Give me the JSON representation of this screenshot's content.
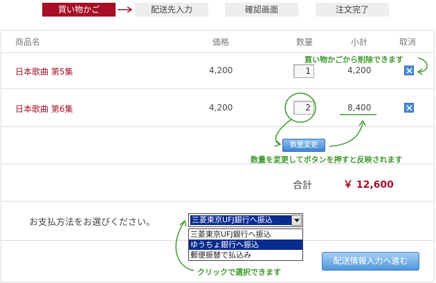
{
  "steps": [
    {
      "label": "買い物かご"
    },
    {
      "label": "配送先入力"
    },
    {
      "label": "確認画面"
    },
    {
      "label": "注文完了"
    }
  ],
  "table": {
    "headers": {
      "name": "商品名",
      "price": "価格",
      "qty": "数量",
      "subtotal": "小計",
      "cancel": "取消"
    },
    "rows": [
      {
        "name": "日本歌曲 第5集",
        "price": "4,200",
        "qty": "1",
        "subtotal": "4,200"
      },
      {
        "name": "日本歌曲 第6集",
        "price": "4,200",
        "qty": "2",
        "subtotal": "8,400"
      }
    ]
  },
  "update_button": "数量変更",
  "notes": {
    "delete": "買い物かごから削除できます",
    "update": "数量を変更してボタンを押すと反映されます",
    "select": "クリックで選択できます"
  },
  "total": {
    "label": "合計",
    "value": "￥ 12,600"
  },
  "payment": {
    "label": "お支払方法をお選びください。",
    "selected": "三菱東京UFJ銀行へ振込",
    "options": [
      "三菱東京UFJ銀行へ振込",
      "ゆうちょ銀行へ振込",
      "郵便振替で払込み"
    ]
  },
  "next_button": "配送情報入力へ進む",
  "colors": {
    "accent": "#a60f25",
    "note": "#3f9a2c",
    "button": "#4f97dc"
  }
}
